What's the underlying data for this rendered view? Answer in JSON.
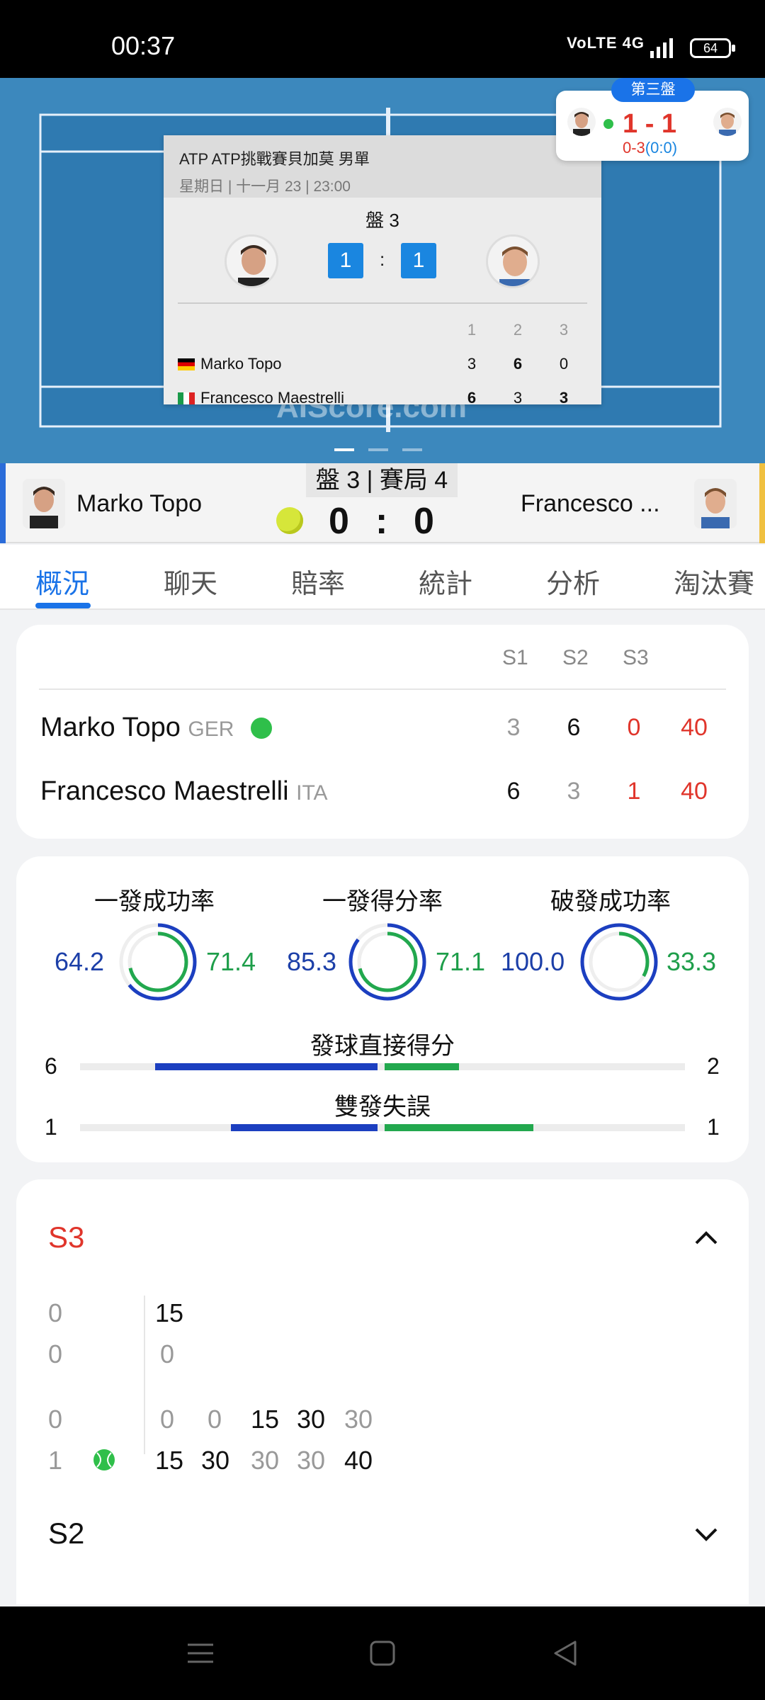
{
  "status_bar": {
    "time": "00:37",
    "signal": "VoLTE 4G",
    "battery": "64"
  },
  "court": {
    "watermark": "AIScore.com"
  },
  "match_card": {
    "title": "ATP ATP挑戰賽貝加莫 男單",
    "datetime": "星期日 | 十一月 23 | 23:00",
    "set_label": "盤 3",
    "home_sets": "1",
    "away_sets": "1",
    "colon": ":",
    "columns": [
      "1",
      "2",
      "3"
    ],
    "rows": [
      {
        "name": "Marko Topo",
        "flag": "de",
        "scores": [
          "3",
          "6",
          "0"
        ]
      },
      {
        "name": "Francesco Maestrelli",
        "flag": "it",
        "scores": [
          "6",
          "3",
          "3"
        ]
      }
    ]
  },
  "mini_score": {
    "tag": "第三盤",
    "score": "1 - 1",
    "sub_red": "0-3",
    "sub_blue": "(0:0)"
  },
  "scoreboard": {
    "home_name": "Marko Topo",
    "away_name": "Francesco ...",
    "game_label": "盤 3 | 賽局 4",
    "home_points": "0",
    "away_points": "0",
    "colon": ":"
  },
  "tabs": [
    "概況",
    "聊天",
    "賠率",
    "統計",
    "分析",
    "淘汰賽"
  ],
  "score_table": {
    "headers": [
      "S1",
      "S2",
      "S3"
    ],
    "rows": [
      {
        "name": "Marko Topo",
        "country": "GER",
        "scores": [
          "3",
          "6",
          "0"
        ],
        "points": "40"
      },
      {
        "name": "Francesco Maestrelli",
        "country": "ITA",
        "scores": [
          "6",
          "3",
          "1"
        ],
        "points": "40"
      }
    ]
  },
  "stats": {
    "rings": [
      {
        "title": "一發成功率",
        "left": "64.2",
        "right": "71.4"
      },
      {
        "title": "一發得分率",
        "left": "85.3",
        "right": "71.1"
      },
      {
        "title": "破發成功率",
        "left": "100.0",
        "right": "33.3"
      }
    ],
    "bars": [
      {
        "title": "發球直接得分",
        "left": "6",
        "right": "2"
      },
      {
        "title": "雙發失誤",
        "left": "1",
        "right": "1"
      }
    ],
    "colors": {
      "home": "#1c3fc0",
      "away": "#22a84e"
    }
  },
  "sets": {
    "s3_label": "S3",
    "s2_label": "S2",
    "game_a": {
      "home_games": "0",
      "away_games": "0",
      "home_pts": [
        "15"
      ],
      "away_pts": [
        "0"
      ]
    },
    "game_b": {
      "home_games": "0",
      "away_games": "1",
      "home_pts": [
        "0",
        "0",
        "15",
        "30",
        "30"
      ],
      "away_pts": [
        "15",
        "30",
        "30",
        "30",
        "40"
      ]
    }
  }
}
